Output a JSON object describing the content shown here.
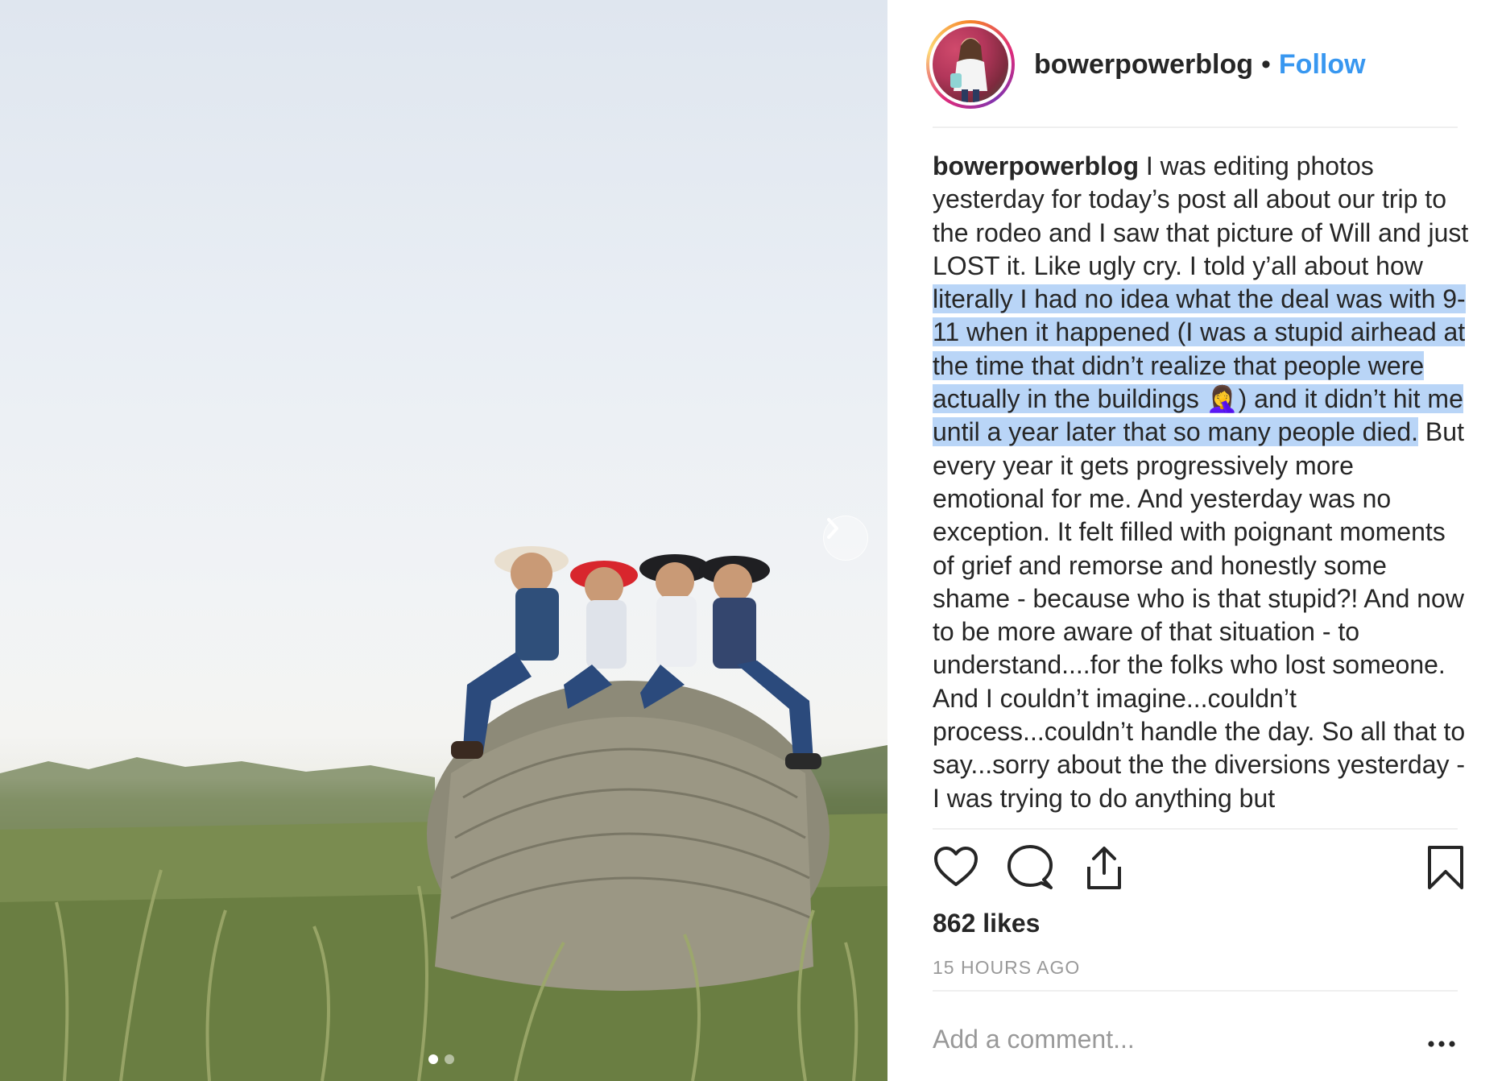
{
  "post": {
    "username": "bowerpowerblog",
    "separator": "•",
    "follow_label": "Follow"
  },
  "caption": {
    "username": "bowerpowerblog",
    "text_before": " I was editing photos yesterday for today’s post all about our trip to the rodeo and I saw that picture of Will and just LOST it. Like ugly cry. I told y’all about how ",
    "text_selected": "literally I had no idea what the deal was with 9-11 when it happened (I was a stupid airhead at the time that didn’t realize that people were actually in the buildings 🤦‍♀️) and it didn’t hit me until a year later that so many people died.",
    "text_after": " But every year it gets progressively more emotional for me. And yesterday was no exception. It felt filled with poignant moments of grief and remorse and honestly some shame - because who is that stupid?! And now to be more aware of that situation - to understand....for the folks who lost someone. And I couldn’t imagine...couldn’t process...couldn’t handle the day. So all that to say...sorry about the the diversions yesterday - I was trying to do anything but"
  },
  "likes_label": "862 likes",
  "timestamp": "15 HOURS AGO",
  "comment": {
    "placeholder": "Add a comment..."
  },
  "carousel": {
    "total": 2,
    "current": 1
  },
  "colors": {
    "accent": "#3897f0",
    "selection": "#b9d5f7",
    "muted": "#999999",
    "text": "#262626"
  },
  "icons": [
    "heart-icon",
    "comment-icon",
    "share-icon",
    "bookmark-icon",
    "more-options-icon",
    "chevron-right-icon"
  ]
}
